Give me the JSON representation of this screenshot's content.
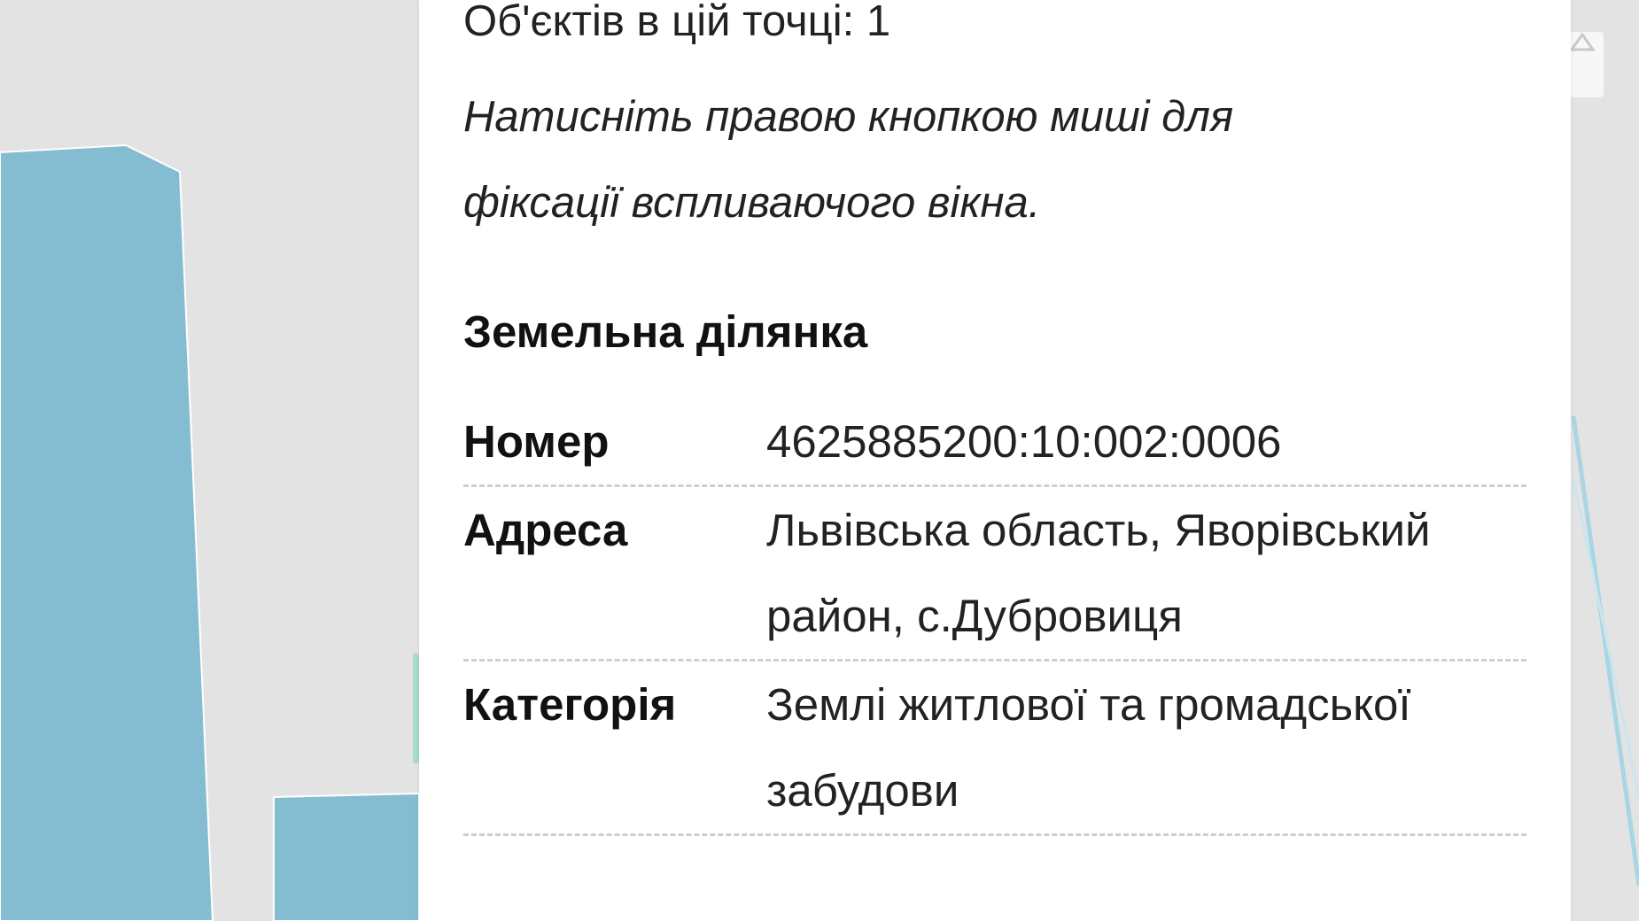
{
  "popup": {
    "objects_count_text": "Об'єктів в цій точці: 1",
    "hint_text": "Натисніть правою кнопкою миші для фіксації вспливаючого вікна.",
    "section_title": "Земельна ділянка",
    "rows": [
      {
        "key": "Номер",
        "value": "4625885200:10:002:0006"
      },
      {
        "key": "Адреса",
        "value": "Львівська область, Яворівський район, с.Дубровиця"
      },
      {
        "key": "Категорія",
        "value": "Землі житлової та громадської забудови"
      }
    ]
  },
  "map": {
    "background_color": "#e3e3e3",
    "parcel_fill_color": "#84bdd1",
    "parcel_outline_color": "#9fd0e0",
    "control_icon": "mountain-icon"
  }
}
